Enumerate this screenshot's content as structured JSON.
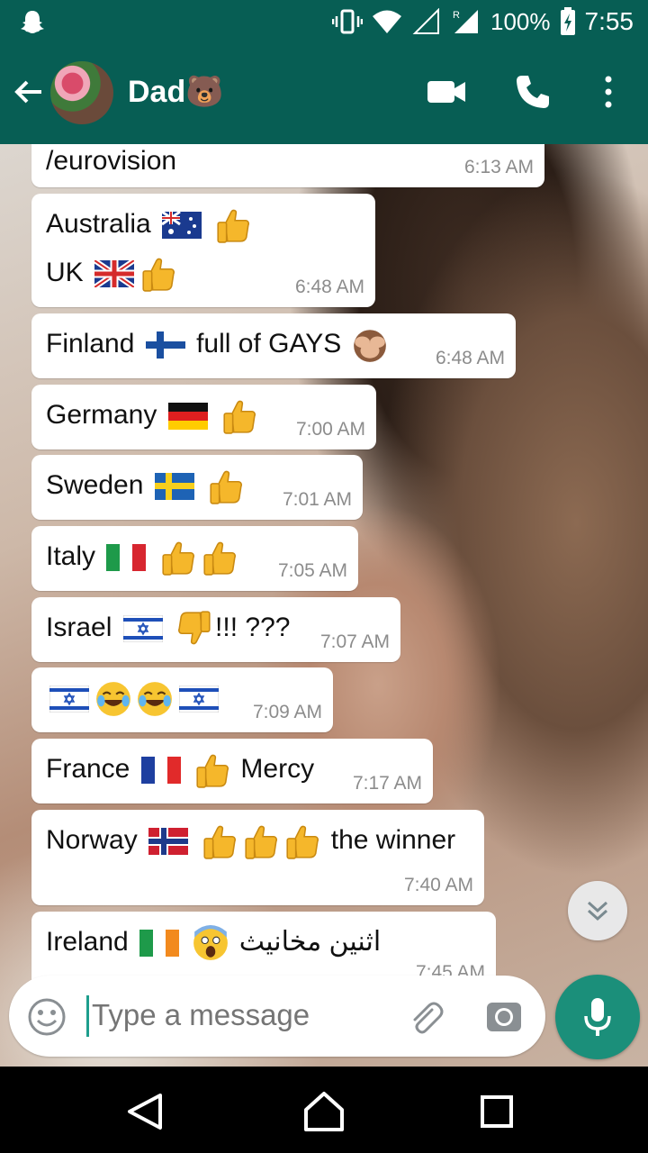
{
  "status_bar": {
    "battery": "100%",
    "time": "7:55"
  },
  "header": {
    "contact_name": "Dad🐻"
  },
  "messages": [
    {
      "text": "/eurovision",
      "time": "6:13 AM"
    },
    {
      "line1": "Australia",
      "line2": "UK",
      "time": "6:48 AM"
    },
    {
      "text_a": "Finland",
      "text_b": "full of GAYS",
      "time": "6:48 AM"
    },
    {
      "text": "Germany",
      "time": "7:00 AM"
    },
    {
      "text": "Sweden",
      "time": "7:01 AM"
    },
    {
      "text": "Italy",
      "time": "7:05 AM"
    },
    {
      "text_a": "Israel",
      "text_b": "!!! ???",
      "time": "7:07 AM"
    },
    {
      "time": "7:09 AM"
    },
    {
      "text_a": "France",
      "text_b": "Mercy",
      "time": "7:17 AM"
    },
    {
      "text_a": "Norway",
      "text_b": "the winner",
      "time": "7:40 AM"
    },
    {
      "text_a": "Ireland",
      "text_b": "اثنين مخانيث",
      "time": "7:45 AM"
    }
  ],
  "input": {
    "placeholder": "Type a message"
  },
  "colors": {
    "header": "#075e54",
    "accent": "#1b8f7a",
    "bubble": "#ffffff"
  },
  "icons": [
    "snapchat-icon",
    "vibrate-icon",
    "wifi-icon",
    "signal-icon",
    "battery-icon",
    "back-arrow-icon",
    "video-call-icon",
    "phone-icon",
    "more-vert-icon",
    "scroll-down-icon",
    "emoji-icon",
    "attach-icon",
    "camera-icon",
    "mic-icon"
  ]
}
